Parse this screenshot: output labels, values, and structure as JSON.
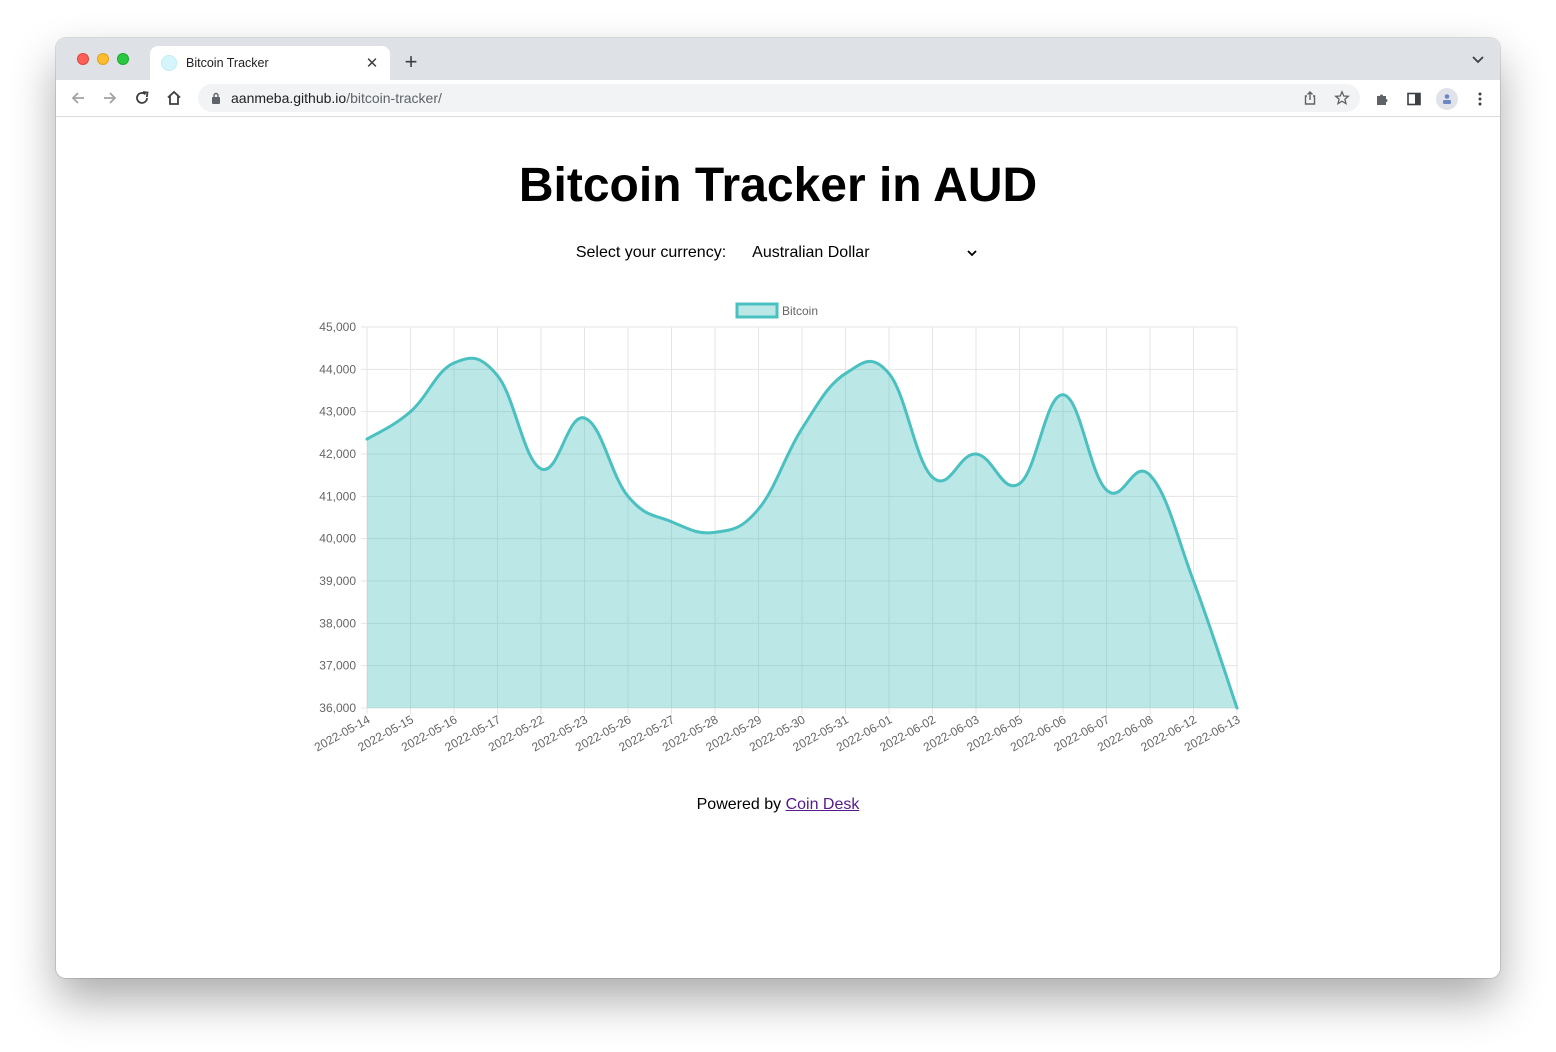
{
  "browser": {
    "tab_title": "Bitcoin Tracker",
    "tab_close": "✕",
    "new_tab": "+",
    "url_host": "aanmeba.github.io",
    "url_path": "/bitcoin-tracker/"
  },
  "page": {
    "title": "Bitcoin Tracker in AUD",
    "currency_label": "Select your currency:",
    "currency_selected": "Australian Dollar",
    "footer_prefix": "Powered by ",
    "footer_link": "Coin Desk"
  },
  "colors": {
    "line": "#4bc0c0",
    "fill": "rgba(75,192,192,0.38)"
  },
  "chart_data": {
    "type": "area",
    "legend": "top",
    "grid": true,
    "series": [
      {
        "name": "Bitcoin",
        "values": [
          42350,
          43000,
          44150,
          43850,
          41650,
          42850,
          41000,
          40400,
          40150,
          40700,
          42600,
          43900,
          43900,
          41450,
          42000,
          41300,
          43400,
          41150,
          41500,
          39000,
          36000
        ]
      }
    ],
    "categories": [
      "2022-05-14",
      "2022-05-15",
      "2022-05-16",
      "2022-05-17",
      "2022-05-22",
      "2022-05-23",
      "2022-05-26",
      "2022-05-27",
      "2022-05-28",
      "2022-05-29",
      "2022-05-30",
      "2022-05-31",
      "2022-06-01",
      "2022-06-02",
      "2022-06-03",
      "2022-06-05",
      "2022-06-06",
      "2022-06-07",
      "2022-06-08",
      "2022-06-12",
      "2022-06-13"
    ],
    "ylim": [
      36000,
      45000
    ],
    "yticks": [
      "45,000",
      "44,000",
      "43,000",
      "42,000",
      "41,000",
      "40,000",
      "39,000",
      "38,000",
      "37,000",
      "36,000"
    ]
  }
}
